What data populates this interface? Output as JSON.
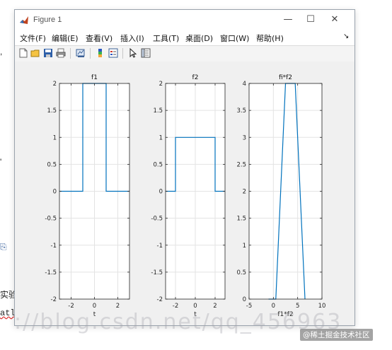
{
  "window": {
    "title": "Figure 1",
    "controls": {
      "minimize": "—",
      "maximize": "☐",
      "close": "✕"
    }
  },
  "menu": {
    "items": [
      "文件(F)",
      "编辑(E)",
      "查看(V)",
      "插入(I)",
      "工具(T)",
      "桌面(D)",
      "窗口(W)",
      "帮助(H)"
    ],
    "dock_glyph": "↘"
  },
  "toolbar": {
    "icons": [
      "new-figure-icon",
      "open-file-icon",
      "save-icon",
      "print-icon",
      "link-plot-icon",
      "insert-colorbar-icon",
      "insert-legend-icon",
      "edit-plot-icon",
      "property-inspector-icon"
    ]
  },
  "colors": {
    "line": "#0072bd",
    "axes_bg": "#ffffff",
    "grid": "#e3e3e3"
  },
  "chart_data": [
    {
      "type": "line",
      "title": "f1",
      "xlabel": "t",
      "ylabel": "",
      "xlim": [
        -3,
        3
      ],
      "ylim": [
        -2,
        2
      ],
      "xticks": [
        -2,
        0,
        2
      ],
      "yticks": [
        -2,
        -1.5,
        -1,
        -0.5,
        0,
        0.5,
        1,
        1.5,
        2
      ],
      "grid": true,
      "x": [
        -3,
        -1,
        -1,
        1,
        1,
        3
      ],
      "y": [
        0,
        0,
        2,
        2,
        0,
        0
      ]
    },
    {
      "type": "line",
      "title": "f2",
      "xlabel": "t",
      "ylabel": "",
      "xlim": [
        -3,
        3
      ],
      "ylim": [
        -2,
        2
      ],
      "xticks": [
        -2,
        0,
        2
      ],
      "yticks": [
        -2,
        -1.5,
        -1,
        -0.5,
        0,
        0.5,
        1,
        1.5,
        2
      ],
      "grid": true,
      "x": [
        -3,
        -2,
        -2,
        2,
        2,
        3
      ],
      "y": [
        0,
        0,
        1,
        1,
        0,
        0
      ]
    },
    {
      "type": "line",
      "title": "fi*f2",
      "xlabel": "f1*f2",
      "ylabel": "",
      "xlim": [
        -5,
        10
      ],
      "ylim": [
        0,
        4
      ],
      "xticks": [
        -5,
        0,
        5,
        10
      ],
      "yticks": [
        0,
        0.5,
        1,
        1.5,
        2,
        2.5,
        3,
        3.5,
        4
      ],
      "grid": true,
      "x": [
        -1,
        0.5,
        2.5,
        4.5,
        6.5
      ],
      "y": [
        0,
        0,
        4,
        4,
        0
      ]
    }
  ],
  "background": {
    "frag_shi": "实验",
    "frag_code": "atla",
    "frag_dot1": ",",
    "frag_dot2": "'",
    "watermark": "://blog.csdn.net/qq_456963",
    "badge": "@稀土掘金技术社区"
  }
}
